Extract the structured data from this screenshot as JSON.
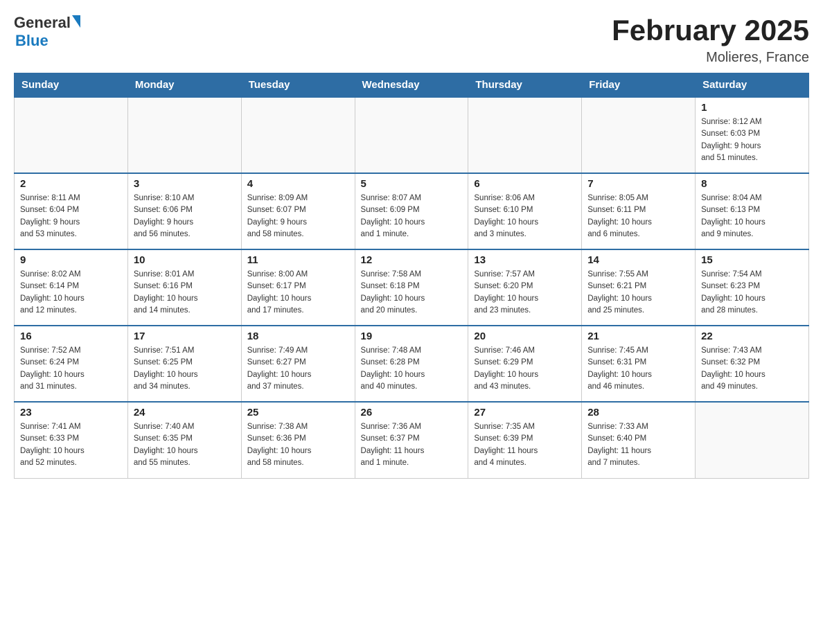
{
  "header": {
    "logo_general": "General",
    "logo_blue": "Blue",
    "title": "February 2025",
    "subtitle": "Molieres, France"
  },
  "days_of_week": [
    "Sunday",
    "Monday",
    "Tuesday",
    "Wednesday",
    "Thursday",
    "Friday",
    "Saturday"
  ],
  "weeks": [
    [
      {
        "day": "",
        "info": ""
      },
      {
        "day": "",
        "info": ""
      },
      {
        "day": "",
        "info": ""
      },
      {
        "day": "",
        "info": ""
      },
      {
        "day": "",
        "info": ""
      },
      {
        "day": "",
        "info": ""
      },
      {
        "day": "1",
        "info": "Sunrise: 8:12 AM\nSunset: 6:03 PM\nDaylight: 9 hours\nand 51 minutes."
      }
    ],
    [
      {
        "day": "2",
        "info": "Sunrise: 8:11 AM\nSunset: 6:04 PM\nDaylight: 9 hours\nand 53 minutes."
      },
      {
        "day": "3",
        "info": "Sunrise: 8:10 AM\nSunset: 6:06 PM\nDaylight: 9 hours\nand 56 minutes."
      },
      {
        "day": "4",
        "info": "Sunrise: 8:09 AM\nSunset: 6:07 PM\nDaylight: 9 hours\nand 58 minutes."
      },
      {
        "day": "5",
        "info": "Sunrise: 8:07 AM\nSunset: 6:09 PM\nDaylight: 10 hours\nand 1 minute."
      },
      {
        "day": "6",
        "info": "Sunrise: 8:06 AM\nSunset: 6:10 PM\nDaylight: 10 hours\nand 3 minutes."
      },
      {
        "day": "7",
        "info": "Sunrise: 8:05 AM\nSunset: 6:11 PM\nDaylight: 10 hours\nand 6 minutes."
      },
      {
        "day": "8",
        "info": "Sunrise: 8:04 AM\nSunset: 6:13 PM\nDaylight: 10 hours\nand 9 minutes."
      }
    ],
    [
      {
        "day": "9",
        "info": "Sunrise: 8:02 AM\nSunset: 6:14 PM\nDaylight: 10 hours\nand 12 minutes."
      },
      {
        "day": "10",
        "info": "Sunrise: 8:01 AM\nSunset: 6:16 PM\nDaylight: 10 hours\nand 14 minutes."
      },
      {
        "day": "11",
        "info": "Sunrise: 8:00 AM\nSunset: 6:17 PM\nDaylight: 10 hours\nand 17 minutes."
      },
      {
        "day": "12",
        "info": "Sunrise: 7:58 AM\nSunset: 6:18 PM\nDaylight: 10 hours\nand 20 minutes."
      },
      {
        "day": "13",
        "info": "Sunrise: 7:57 AM\nSunset: 6:20 PM\nDaylight: 10 hours\nand 23 minutes."
      },
      {
        "day": "14",
        "info": "Sunrise: 7:55 AM\nSunset: 6:21 PM\nDaylight: 10 hours\nand 25 minutes."
      },
      {
        "day": "15",
        "info": "Sunrise: 7:54 AM\nSunset: 6:23 PM\nDaylight: 10 hours\nand 28 minutes."
      }
    ],
    [
      {
        "day": "16",
        "info": "Sunrise: 7:52 AM\nSunset: 6:24 PM\nDaylight: 10 hours\nand 31 minutes."
      },
      {
        "day": "17",
        "info": "Sunrise: 7:51 AM\nSunset: 6:25 PM\nDaylight: 10 hours\nand 34 minutes."
      },
      {
        "day": "18",
        "info": "Sunrise: 7:49 AM\nSunset: 6:27 PM\nDaylight: 10 hours\nand 37 minutes."
      },
      {
        "day": "19",
        "info": "Sunrise: 7:48 AM\nSunset: 6:28 PM\nDaylight: 10 hours\nand 40 minutes."
      },
      {
        "day": "20",
        "info": "Sunrise: 7:46 AM\nSunset: 6:29 PM\nDaylight: 10 hours\nand 43 minutes."
      },
      {
        "day": "21",
        "info": "Sunrise: 7:45 AM\nSunset: 6:31 PM\nDaylight: 10 hours\nand 46 minutes."
      },
      {
        "day": "22",
        "info": "Sunrise: 7:43 AM\nSunset: 6:32 PM\nDaylight: 10 hours\nand 49 minutes."
      }
    ],
    [
      {
        "day": "23",
        "info": "Sunrise: 7:41 AM\nSunset: 6:33 PM\nDaylight: 10 hours\nand 52 minutes."
      },
      {
        "day": "24",
        "info": "Sunrise: 7:40 AM\nSunset: 6:35 PM\nDaylight: 10 hours\nand 55 minutes."
      },
      {
        "day": "25",
        "info": "Sunrise: 7:38 AM\nSunset: 6:36 PM\nDaylight: 10 hours\nand 58 minutes."
      },
      {
        "day": "26",
        "info": "Sunrise: 7:36 AM\nSunset: 6:37 PM\nDaylight: 11 hours\nand 1 minute."
      },
      {
        "day": "27",
        "info": "Sunrise: 7:35 AM\nSunset: 6:39 PM\nDaylight: 11 hours\nand 4 minutes."
      },
      {
        "day": "28",
        "info": "Sunrise: 7:33 AM\nSunset: 6:40 PM\nDaylight: 11 hours\nand 7 minutes."
      },
      {
        "day": "",
        "info": ""
      }
    ]
  ]
}
